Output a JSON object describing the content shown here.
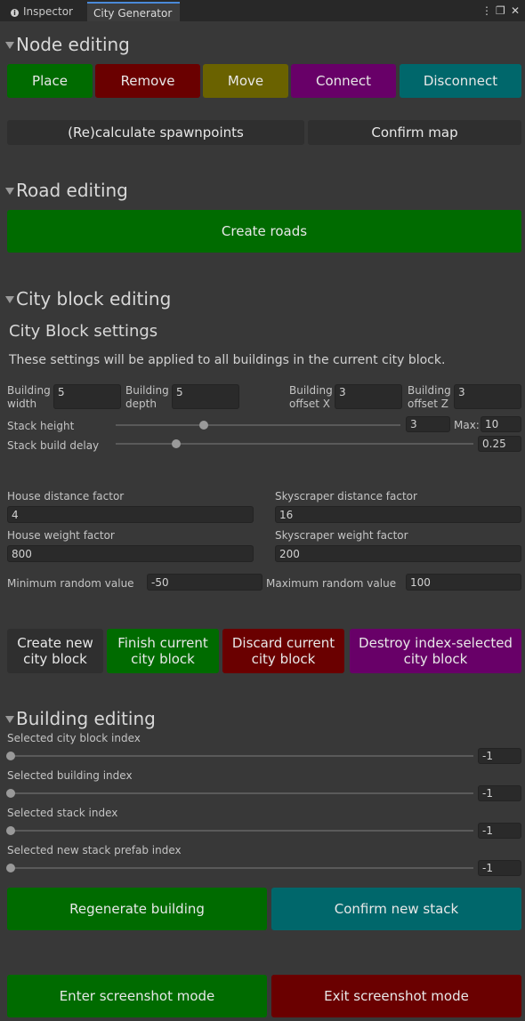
{
  "tabs": {
    "inspector": "Inspector",
    "city_generator": "City Generator"
  },
  "node_editing": {
    "header": "Node editing",
    "buttons": {
      "place": "Place",
      "remove": "Remove",
      "move": "Move",
      "connect": "Connect",
      "disconnect": "Disconnect"
    },
    "recalc": "(Re)calculate spawnpoints",
    "confirm": "Confirm map"
  },
  "road_editing": {
    "header": "Road editing",
    "create": "Create roads"
  },
  "city_block_editing": {
    "header": "City block editing",
    "settings_title": "City Block settings",
    "settings_desc": "These settings will be applied to all buildings in the current city block.",
    "building_width": {
      "label1": "Building",
      "label2": "width",
      "value": "5"
    },
    "building_depth": {
      "label1": "Building",
      "label2": "depth",
      "value": "5"
    },
    "offset_x": {
      "label1": "Building",
      "label2": "offset X",
      "value": "3"
    },
    "offset_z": {
      "label1": "Building",
      "label2": "offset Z",
      "value": "3"
    },
    "stack_height": {
      "label": "Stack height",
      "value": "3",
      "max_label": "Max:",
      "max_value": "10",
      "fraction": 0.31
    },
    "stack_delay": {
      "label": "Stack build delay",
      "value": "0.25",
      "fraction": 0.17
    },
    "house_distance": {
      "label": "House distance factor",
      "value": "4"
    },
    "skyscraper_distance": {
      "label": "Skyscraper distance factor",
      "value": "16"
    },
    "house_weight": {
      "label": "House weight factor",
      "value": "800"
    },
    "skyscraper_weight": {
      "label": "Skyscraper weight factor",
      "value": "200"
    },
    "min_random": {
      "label": "Minimum random value",
      "value": "-50"
    },
    "max_random": {
      "label": "Maximum random value",
      "value": "100"
    },
    "buttons": {
      "create_1": "Create new",
      "create_2": "city block",
      "finish_1": "Finish current",
      "finish_2": "city block",
      "discard_1": "Discard current",
      "discard_2": "city block",
      "destroy_1": "Destroy index-selected",
      "destroy_2": "city block"
    }
  },
  "building_editing": {
    "header": "Building editing",
    "city_block_index": {
      "label": "Selected city block index",
      "value": "-1",
      "fraction": 0
    },
    "building_index": {
      "label": "Selected building index",
      "value": "-1",
      "fraction": 0
    },
    "stack_index": {
      "label": "Selected stack index",
      "value": "-1",
      "fraction": 0
    },
    "prefab_index": {
      "label": "Selected new stack prefab index",
      "value": "-1",
      "fraction": 0
    },
    "regenerate": "Regenerate building",
    "confirm_stack": "Confirm new stack"
  },
  "screenshot": {
    "enter": "Enter screenshot mode",
    "exit": "Exit screenshot mode"
  },
  "colors": {
    "green": "#006b00",
    "red": "#6a0000",
    "olive": "#6a6200",
    "purple": "#680068",
    "teal": "#00676b",
    "dark": "#2f2f2f",
    "background": "#383838"
  }
}
